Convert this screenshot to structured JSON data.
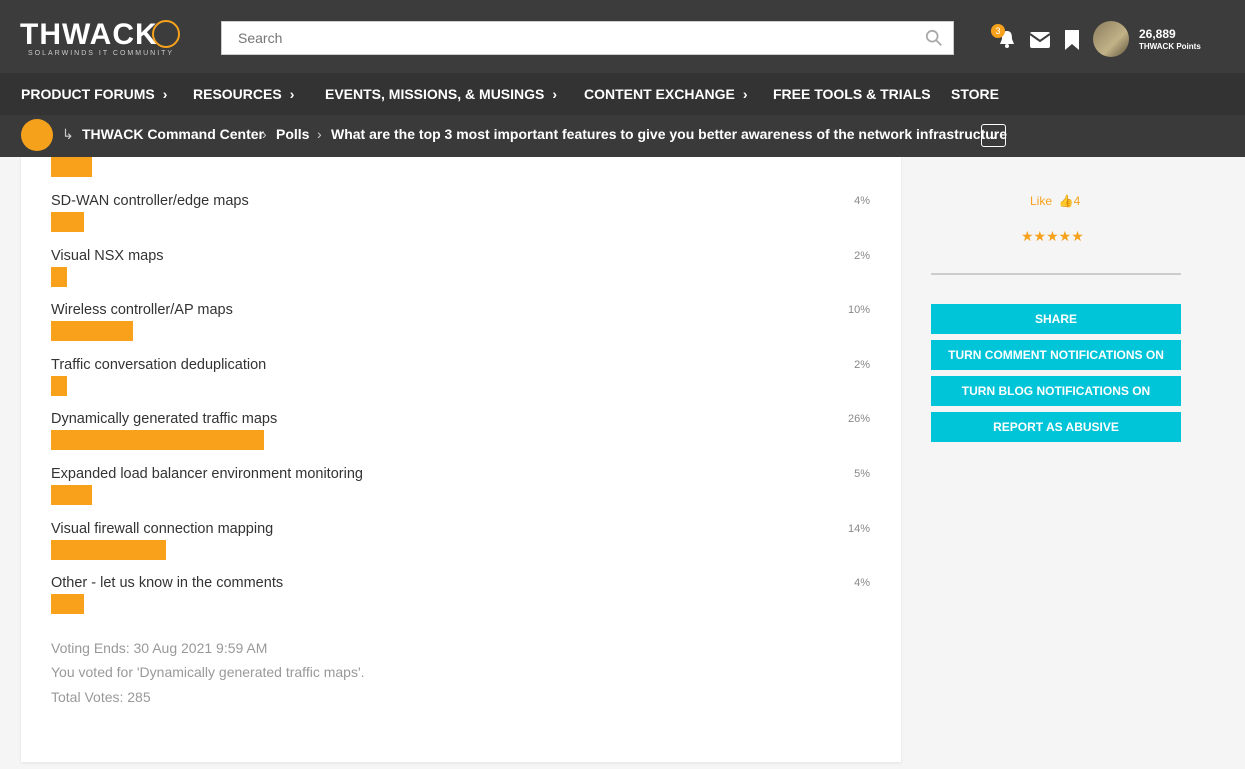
{
  "header": {
    "logo_text": "THWACK",
    "logo_sub": "SOLARWINDS IT COMMUNITY",
    "search_placeholder": "Search",
    "notifications_count": "3",
    "points": "26,889",
    "points_label": "THWACK Points"
  },
  "nav": {
    "items": [
      {
        "label": "PRODUCT FORUMS",
        "chevron": true
      },
      {
        "label": "RESOURCES",
        "chevron": true
      },
      {
        "label": "EVENTS, MISSIONS, & MUSINGS",
        "chevron": true
      },
      {
        "label": "CONTENT EXCHANGE",
        "chevron": true
      },
      {
        "label": "FREE TOOLS & TRIALS",
        "chevron": false
      },
      {
        "label": "STORE",
        "chevron": false
      }
    ]
  },
  "breadcrumb": {
    "items": [
      "THWACK Command Center",
      "Polls",
      "What are the top 3 most important features to give you better awareness of the network infrastructure"
    ]
  },
  "poll": {
    "options": [
      {
        "label": "SD-WAN controller/edge maps",
        "percent": "4%",
        "value": 4
      },
      {
        "label": "Visual NSX maps",
        "percent": "2%",
        "value": 2
      },
      {
        "label": "Wireless controller/AP maps",
        "percent": "10%",
        "value": 10
      },
      {
        "label": "Traffic conversation deduplication",
        "percent": "2%",
        "value": 2
      },
      {
        "label": "Dynamically generated traffic maps",
        "percent": "26%",
        "value": 26
      },
      {
        "label": "Expanded load balancer environment monitoring",
        "percent": "5%",
        "value": 5
      },
      {
        "label": "Visual firewall connection mapping",
        "percent": "14%",
        "value": 14
      },
      {
        "label": "Other - let us know in the comments",
        "percent": "4%",
        "value": 4
      }
    ],
    "partial_top_bar_value": 5,
    "voting_ends": "Voting Ends: 30 Aug 2021 9:59 AM",
    "you_voted": "You voted for 'Dynamically generated traffic maps'.",
    "total_votes": "Total Votes: 285"
  },
  "sidebar": {
    "like_label": "Like",
    "like_count": "4",
    "rating": 5,
    "buttons": [
      "SHARE",
      "TURN COMMENT NOTIFICATIONS ON",
      "TURN BLOG NOTIFICATIONS ON",
      "REPORT AS ABUSIVE"
    ]
  },
  "colors": {
    "accent": "#f9a11b",
    "cyan": "#00c4d8",
    "header_bg": "#3c3c3c"
  }
}
